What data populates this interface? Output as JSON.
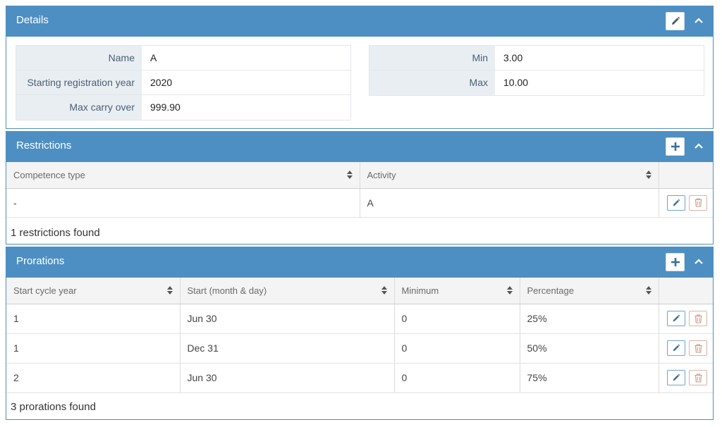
{
  "details": {
    "title": "Details",
    "left_fields": [
      {
        "label": "Name",
        "value": "A"
      },
      {
        "label": "Starting registration year",
        "value": "2020"
      },
      {
        "label": "Max carry over",
        "value": "999.90"
      }
    ],
    "right_fields": [
      {
        "label": "Min",
        "value": "3.00"
      },
      {
        "label": "Max",
        "value": "10.00"
      }
    ]
  },
  "restrictions": {
    "title": "Restrictions",
    "columns": [
      "Competence type",
      "Activity"
    ],
    "rows": [
      [
        "-",
        "A"
      ]
    ],
    "footer": "1 restrictions found"
  },
  "prorations": {
    "title": "Prorations",
    "columns": [
      "Start cycle year",
      "Start (month & day)",
      "Minimum",
      "Percentage"
    ],
    "rows": [
      [
        "1",
        "Jun 30",
        "0",
        "25%"
      ],
      [
        "1",
        "Dec 31",
        "0",
        "50%"
      ],
      [
        "2",
        "Jun 30",
        "0",
        "75%"
      ]
    ],
    "footer": "3 prorations found"
  },
  "icons": {
    "edit": "pencil-icon",
    "add": "plus-icon",
    "collapse": "chevron-up-icon",
    "delete": "trash-icon",
    "sort": "sort-icon"
  },
  "colors": {
    "header": "#4e8fc3",
    "label_bg": "#e9eef3"
  }
}
